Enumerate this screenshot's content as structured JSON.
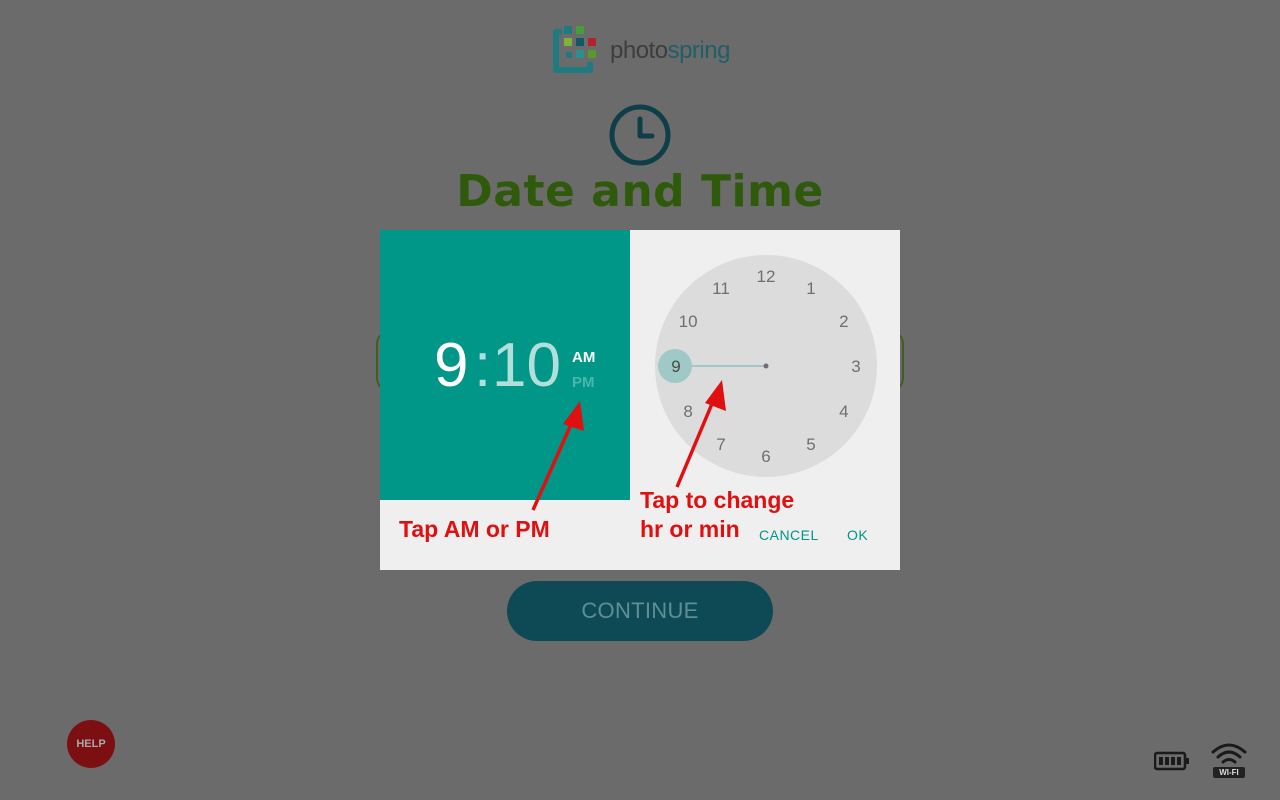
{
  "brand": {
    "name_part1": "photo",
    "name_part2": "spring"
  },
  "page": {
    "title": "Date and Time"
  },
  "time_picker": {
    "hour": "9",
    "separator": ":",
    "minute": "10",
    "am_label": "AM",
    "pm_label": "PM",
    "selected_period": "AM",
    "dial_numbers": [
      "12",
      "1",
      "2",
      "3",
      "4",
      "5",
      "6",
      "7",
      "8",
      "9",
      "10",
      "11"
    ],
    "selected_hour": 9,
    "cancel_label": "CANCEL",
    "ok_label": "OK",
    "accent_color": "#009688"
  },
  "annotations": {
    "ampm_hint": "Tap AM or PM",
    "hr_hint_line1": "Tap to change",
    "hr_hint_line2": "hr or min"
  },
  "continue_label": "CONTINUE",
  "help_label": "HELP",
  "status": {
    "wifi_label": "WI-FI"
  },
  "icons": [
    "clock-icon",
    "battery-icon",
    "wifi-icon"
  ]
}
